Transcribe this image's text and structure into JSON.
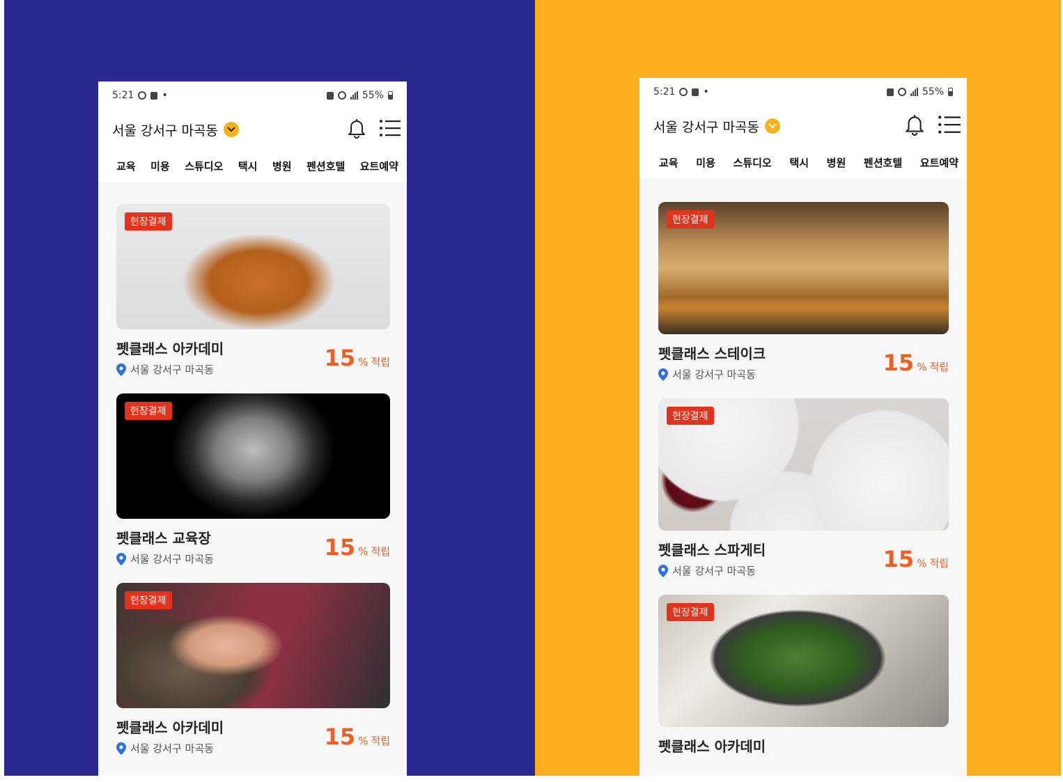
{
  "left_phone": {
    "status": {
      "time": "5:21",
      "battery": "55%"
    },
    "location": "서울 강서구 마곡동",
    "categories": [
      "교육",
      "미용",
      "스튜디오",
      "택시",
      "병원",
      "펜션호텔",
      "요트예약"
    ],
    "cards": [
      {
        "badge": "현장결제",
        "name": "펫클래스 아카데미",
        "address": "서울 강서구 마곡동",
        "reward_value": "15",
        "reward_unit": "%",
        "reward_label": "적립"
      },
      {
        "badge": "현장결제",
        "name": "펫클래스 교육장",
        "address": "서울 강서구 마곡동",
        "reward_value": "15",
        "reward_unit": "%",
        "reward_label": "적립"
      },
      {
        "badge": "현장결제",
        "name": "펫클래스 아카데미",
        "address": "서울 강서구 마곡동",
        "reward_value": "15",
        "reward_unit": "%",
        "reward_label": "적립"
      }
    ]
  },
  "right_phone": {
    "status": {
      "time": "5:21",
      "battery": "55%"
    },
    "location": "서울 강서구 마곡동",
    "categories": [
      "교육",
      "미용",
      "스튜디오",
      "택시",
      "병원",
      "펜션호텔",
      "요트예약"
    ],
    "cards": [
      {
        "badge": "현장결제",
        "name": "펫클래스 스테이크",
        "address": "서울 강서구 마곡동",
        "reward_value": "15",
        "reward_unit": "%",
        "reward_label": "적립"
      },
      {
        "badge": "현장결제",
        "name": "펫클래스 스파게티",
        "address": "서울 강서구 마곡동",
        "reward_value": "15",
        "reward_unit": "%",
        "reward_label": "적립"
      },
      {
        "badge": "현장결제",
        "name": "펫클래스 아카데미"
      }
    ]
  },
  "colors": {
    "left_bg": "#29298f",
    "right_bg": "#fdae1e",
    "accent": "#f25e1f",
    "badge": "#e2341d",
    "chevron": "#f6b21b",
    "pin": "#2f6fe0"
  },
  "icons": [
    "chevron-down-icon",
    "bell-icon",
    "menu-icon",
    "location-pin-icon"
  ]
}
